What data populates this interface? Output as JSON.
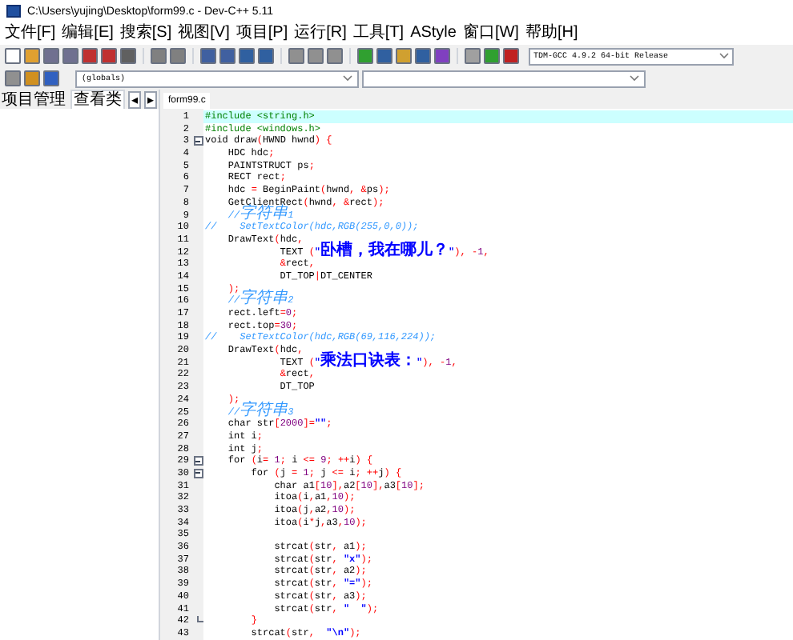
{
  "window": {
    "title": "C:\\Users\\yujing\\Desktop\\form99.c - Dev-C++ 5.11"
  },
  "menu": [
    "文件[F]",
    "编辑[E]",
    "搜索[S]",
    "视图[V]",
    "项目[P]",
    "运行[R]",
    "工具[T]",
    "AStyle",
    "窗口[W]",
    "帮助[H]"
  ],
  "compiler_select": {
    "value": "TDM-GCC 4.9.2 64-bit Release"
  },
  "scope_select": {
    "value": "(globals)"
  },
  "side_tabs": [
    {
      "label": "项目管理",
      "selected": false
    },
    {
      "label": "查看类",
      "selected": true
    }
  ],
  "side_tab_arrows": [
    "◂",
    "▸"
  ],
  "editor_tabs": [
    {
      "label": "form99.c",
      "selected": true
    }
  ],
  "code_lines": [
    {
      "number": "1",
      "kind": "preprocessor",
      "text": "#include <string.h>",
      "highlighted": true
    },
    {
      "number": "2",
      "kind": "preprocessor",
      "text": "#include <windows.h>",
      "highlighted": false
    },
    {
      "number": "3",
      "kind": "code",
      "text": "void draw(HWND hwnd) {",
      "highlighted": false,
      "expanded": true
    },
    {
      "number": "4",
      "kind": "code",
      "text": "    HDC hdc;",
      "highlighted": false
    },
    {
      "number": "5",
      "kind": "code",
      "text": "    PAINTSTRUCT ps;",
      "highlighted": false
    },
    {
      "number": "6",
      "kind": "code",
      "text": "    RECT rect;",
      "highlighted": false
    },
    {
      "number": "7",
      "kind": "code",
      "text": "    hdc = BeginPaint(hwnd, &ps);",
      "highlighted": false
    },
    {
      "number": "8",
      "kind": "code",
      "text": "    GetClientRect(hwnd, &rect);",
      "highlighted": false
    },
    {
      "number": "9",
      "kind": "comment",
      "text": "    //字符串1",
      "highlighted": false
    },
    {
      "number": "10",
      "kind": "comment",
      "text": "//    SetTextColor(hdc,RGB(255,0,0));",
      "highlighted": false
    },
    {
      "number": "11",
      "kind": "code",
      "text": "    DrawText(hdc,",
      "highlighted": false
    },
    {
      "number": "12",
      "kind": "code",
      "text": "             TEXT (\"卧槽，我在哪儿？\"), -1,",
      "highlighted": false
    },
    {
      "number": "13",
      "kind": "code",
      "text": "             &rect,",
      "highlighted": false
    },
    {
      "number": "14",
      "kind": "code",
      "text": "             DT_TOP|DT_CENTER",
      "highlighted": false
    },
    {
      "number": "15",
      "kind": "code",
      "text": "    );",
      "highlighted": false
    },
    {
      "number": "16",
      "kind": "comment",
      "text": "    //字符串2",
      "highlighted": false
    },
    {
      "number": "17",
      "kind": "code",
      "text": "    rect.left=0;",
      "highlighted": false
    },
    {
      "number": "18",
      "kind": "code",
      "text": "    rect.top=30;",
      "highlighted": false
    },
    {
      "number": "19",
      "kind": "comment",
      "text": "//    SetTextColor(hdc,RGB(69,116,224));",
      "highlighted": false
    },
    {
      "number": "20",
      "kind": "code",
      "text": "    DrawText(hdc,",
      "highlighted": false
    },
    {
      "number": "21",
      "kind": "code",
      "text": "             TEXT (\"乘法口诀表：\"), -1,",
      "highlighted": false
    },
    {
      "number": "22",
      "kind": "code",
      "text": "             &rect,",
      "highlighted": false
    },
    {
      "number": "23",
      "kind": "code",
      "text": "             DT_TOP",
      "highlighted": false
    },
    {
      "number": "24",
      "kind": "code",
      "text": "    );",
      "highlighted": false
    },
    {
      "number": "25",
      "kind": "comment",
      "text": "    //字符串3",
      "highlighted": false
    },
    {
      "number": "26",
      "kind": "code",
      "text": "    char str[2000]=\"\";",
      "highlighted": false
    },
    {
      "number": "27",
      "kind": "code",
      "text": "    int i;",
      "highlighted": false
    },
    {
      "number": "28",
      "kind": "code",
      "text": "    int j;",
      "highlighted": false
    },
    {
      "number": "29",
      "kind": "code",
      "text": "    for (i= 1; i <= 9; ++i) {",
      "highlighted": false,
      "expanded": true
    },
    {
      "number": "30",
      "kind": "code",
      "text": "        for (j = 1; j <= i; ++j) {",
      "highlighted": false,
      "expanded": true
    },
    {
      "number": "31",
      "kind": "code",
      "text": "            char a1[10],a2[10],a3[10];",
      "highlighted": false
    },
    {
      "number": "32",
      "kind": "code",
      "text": "            itoa(i,a1,10);",
      "highlighted": false
    },
    {
      "number": "33",
      "kind": "code",
      "text": "            itoa(j,a2,10);",
      "highlighted": false
    },
    {
      "number": "34",
      "kind": "code",
      "text": "            itoa(i*j,a3,10);",
      "highlighted": false
    },
    {
      "number": "35",
      "kind": "code",
      "highlighted": false
    },
    {
      "number": "36",
      "kind": "code",
      "text": "            strcat(str, a1);",
      "highlighted": false
    },
    {
      "number": "37",
      "kind": "code",
      "text": "            strcat(str, \"x\");",
      "highlighted": false
    },
    {
      "number": "38",
      "kind": "code",
      "text": "            strcat(str, a2);",
      "highlighted": false
    },
    {
      "number": "39",
      "kind": "code",
      "text": "            strcat(str, \"=\");",
      "highlighted": false
    },
    {
      "number": "40",
      "kind": "code",
      "text": "            strcat(str, a3);",
      "highlighted": false
    },
    {
      "number": "41",
      "kind": "code",
      "text": "            strcat(str, \"  \");",
      "highlighted": false
    },
    {
      "number": "42",
      "kind": "code",
      "text": "        }",
      "highlighted": false,
      "block_end": true
    },
    {
      "number": "43",
      "kind": "code",
      "text": "        strcat(str,  \"\\n\");",
      "highlighted": false
    }
  ]
}
